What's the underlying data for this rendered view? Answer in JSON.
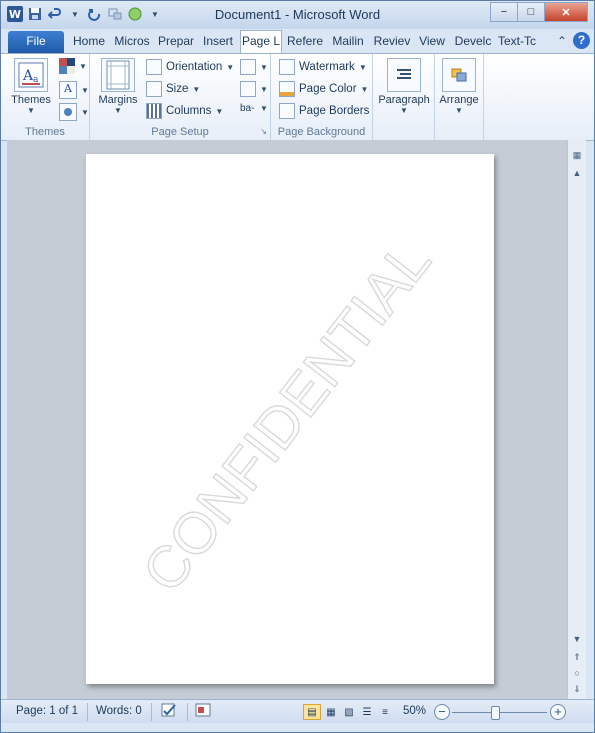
{
  "window": {
    "title": "Document1 - Microsoft Word",
    "controls": {
      "minimize": "−",
      "maximize": "□",
      "close": "✕"
    }
  },
  "quick_access": {
    "app_icon": "W",
    "items": [
      "save-icon",
      "undo-icon",
      "redo-icon",
      "touch-mode-icon",
      "circle-icon",
      "customize-qat-icon"
    ]
  },
  "tabs": [
    {
      "label": "File"
    },
    {
      "label": "Home"
    },
    {
      "label": "Micros"
    },
    {
      "label": "Prepar"
    },
    {
      "label": "Insert"
    },
    {
      "label": "Page L"
    },
    {
      "label": "Refere"
    },
    {
      "label": "Mailin"
    },
    {
      "label": "Reviev"
    },
    {
      "label": "View"
    },
    {
      "label": "Develc"
    },
    {
      "label": "Text-Tc"
    }
  ],
  "help": {
    "label": "?"
  },
  "ribbon": {
    "themes_group": {
      "label": "Themes",
      "themes_button": "Themes"
    },
    "page_setup_group": {
      "label": "Page Setup",
      "margins": "Margins",
      "orientation": "Orientation",
      "size": "Size",
      "columns": "Columns"
    },
    "page_background_group": {
      "label": "Page Background",
      "watermark": "Watermark",
      "page_color": "Page Color",
      "page_borders": "Page Borders"
    },
    "paragraph": "Paragraph",
    "arrange": "Arrange"
  },
  "document": {
    "watermark_text": "CONFIDENTIAL"
  },
  "status": {
    "page": "Page: 1 of 1",
    "words": "Words: 0",
    "zoom": "50%",
    "zoom_fraction": 0.5
  },
  "colors": {
    "accent": "#2b579a",
    "file_tab": "#2a65b8"
  }
}
